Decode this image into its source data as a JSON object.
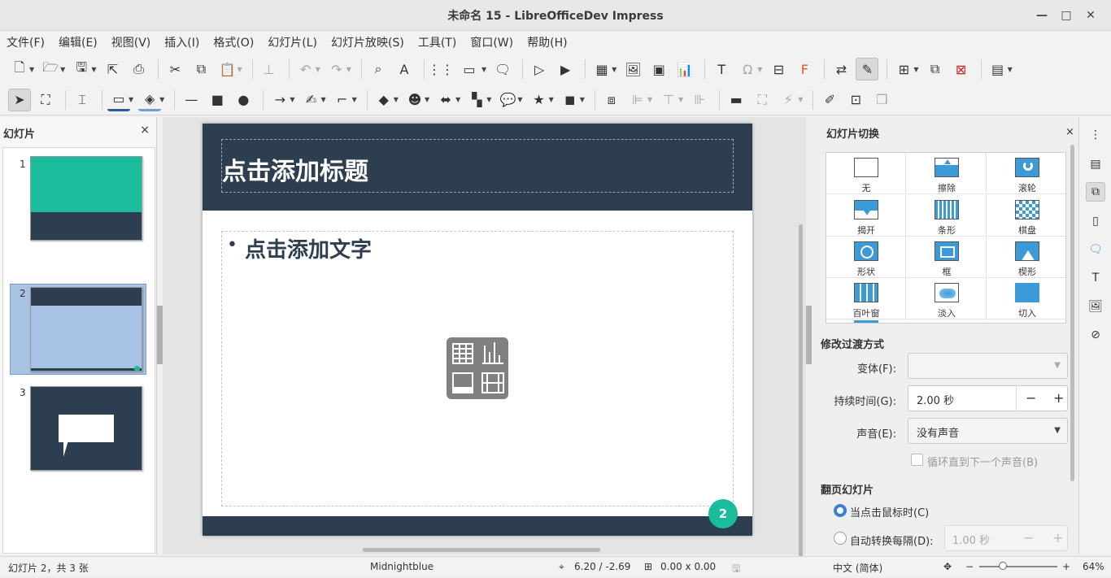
{
  "window": {
    "title": "未命名 15 - LibreOfficeDev Impress"
  },
  "menu": [
    "文件(F)",
    "编辑(E)",
    "视图(V)",
    "插入(I)",
    "格式(O)",
    "幻灯片(L)",
    "幻灯片放映(S)",
    "工具(T)",
    "窗口(W)",
    "帮助(H)"
  ],
  "slides_panel": {
    "title": "幻灯片",
    "numbers": [
      "1",
      "2",
      "3"
    ],
    "selected": 2
  },
  "slide": {
    "title_placeholder": "点击添加标题",
    "content_placeholder": "点击添加文字",
    "bullet": "•",
    "page_number": "2",
    "theme_colors": {
      "header": "#2c3e50",
      "accent": "#1abc9c"
    }
  },
  "sidebar": {
    "title": "幻灯片切换",
    "transitions": [
      "无",
      "擦除",
      "滚轮",
      "揭开",
      "条形",
      "棋盘",
      "形状",
      "框",
      "楔形",
      "百叶窗",
      "淡入",
      "切入"
    ],
    "modify_section": "修改过渡方式",
    "variant_label": "变体(F):",
    "variant_value": "",
    "duration_label": "持续时间(G):",
    "duration_value": "2.00 秒",
    "minus": "−",
    "plus": "+",
    "sound_label": "声音(E):",
    "sound_value": "没有声音",
    "loop_label": "循环直到下一个声音(B)",
    "advance_section": "翻页幻灯片",
    "on_click_label": "当点击鼠标时(C)",
    "auto_label": "自动转换每隔(D):",
    "auto_value": "1.00 秒"
  },
  "statusbar": {
    "slide_info": "幻灯片 2，共 3 张",
    "master": "Midnightblue",
    "position": "6.20 / -2.69",
    "size": "0.00 x 0.00",
    "language": "中文 (简体)",
    "zoom": "64%",
    "zoom_minus": "−",
    "zoom_plus": "+"
  }
}
